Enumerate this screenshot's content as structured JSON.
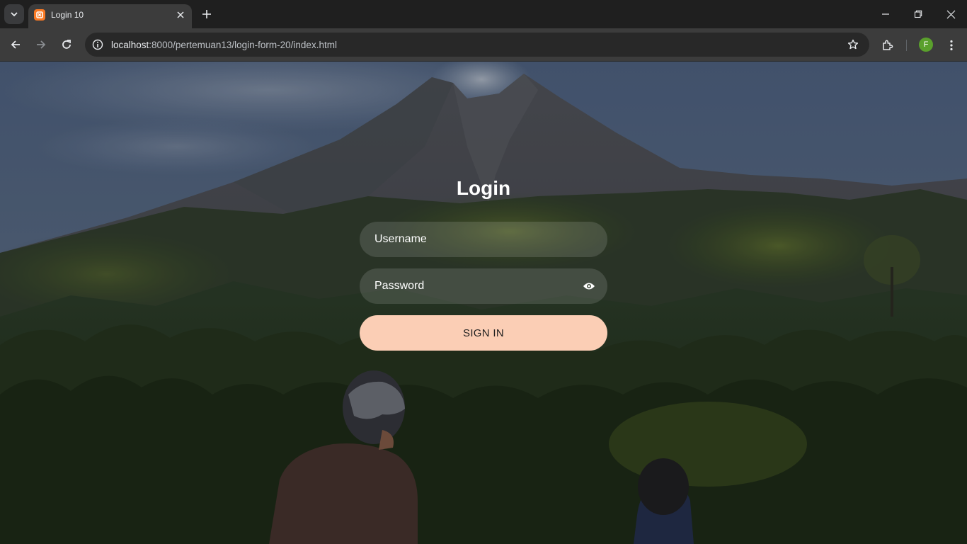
{
  "browser": {
    "tab_title": "Login 10",
    "url_host": "localhost",
    "url_rest": ":8000/pertemuan13/login-form-20/index.html",
    "profile_initial": "F"
  },
  "login": {
    "title": "Login",
    "username_placeholder": "Username",
    "password_placeholder": "Password",
    "submit_label": "SIGN IN"
  },
  "colors": {
    "button_bg": "#fbceb5",
    "field_bg": "rgba(255,255,255,0.13)"
  },
  "icons": [
    "tab-search-icon",
    "favicon",
    "close-icon",
    "plus-icon",
    "minimize-icon",
    "restore-icon",
    "window-close-icon",
    "back-icon",
    "forward-icon",
    "reload-icon",
    "site-info-icon",
    "star-icon",
    "extensions-icon",
    "kebab-menu-icon",
    "eye-icon"
  ]
}
